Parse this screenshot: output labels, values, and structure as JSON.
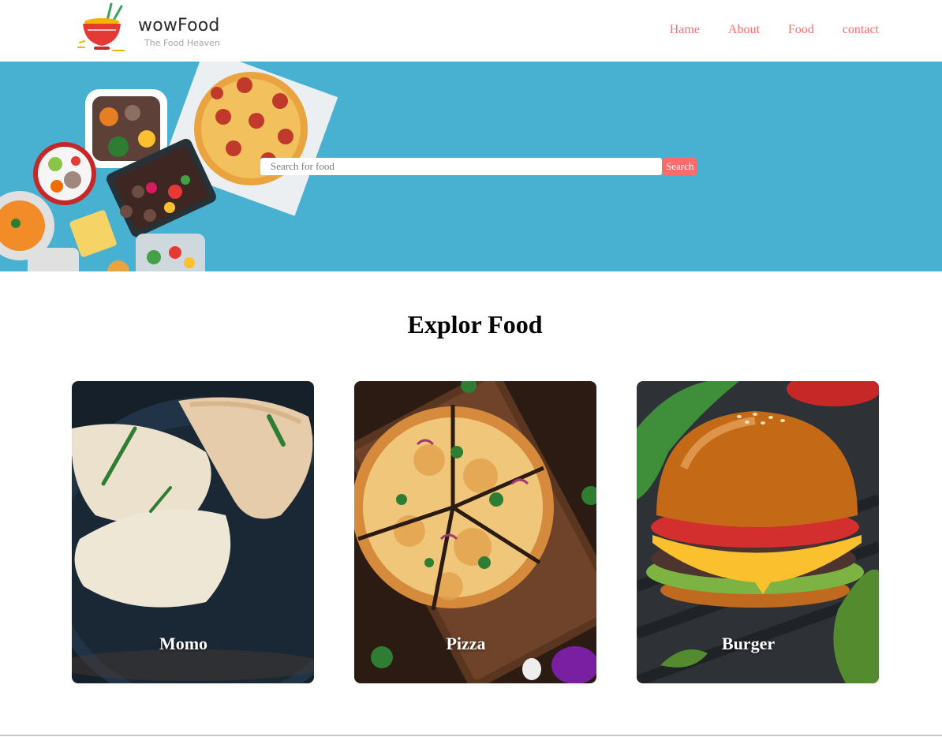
{
  "brand": {
    "name": "wowFood",
    "tagline": "The Food Heaven"
  },
  "nav": {
    "items": [
      "Hame",
      "About",
      "Food",
      "contact"
    ]
  },
  "search": {
    "placeholder": "Search for food",
    "button_label": "Search"
  },
  "explore": {
    "title": "Explor Food",
    "cards": [
      {
        "label": "Momo"
      },
      {
        "label": "Pizza"
      },
      {
        "label": "Burger"
      }
    ]
  },
  "colors": {
    "accent": "#ff6b6b",
    "hero_background": "#48b1d2"
  }
}
